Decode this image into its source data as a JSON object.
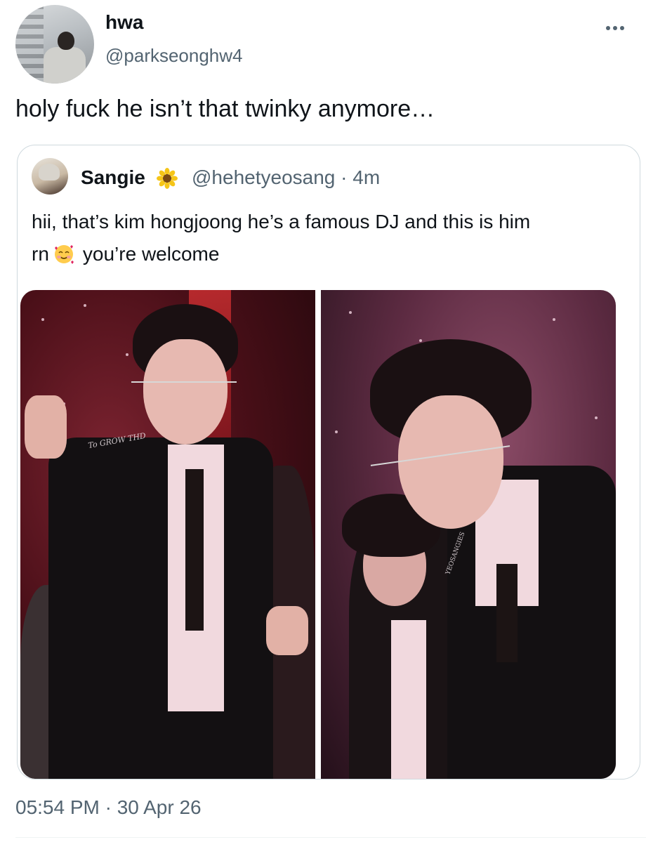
{
  "tweet": {
    "author": {
      "display_name": "hwa",
      "handle": "@parkseonghw4"
    },
    "text": "holy fuck he isn’t that twinky anymore…",
    "timestamp": "05:54 PM · 30 Apr 26",
    "more_icon": "more-horizontal-icon"
  },
  "quote": {
    "author": {
      "display_name": "Sangie",
      "handle": "@hehetyeosang",
      "time": "4m",
      "separator": " · "
    },
    "name_emoji_icon": "sunflower-icon",
    "text_line1": "hii, that’s kim hongjoong he’s a famous DJ and this is him",
    "text_line2_start": "rn",
    "text_emoji_icon": "smiling-face-with-hearts-icon",
    "text_line2_end": "you’re welcome",
    "photos": [
      {
        "name": "photo-performer-pointing",
        "watermark": "To GROW THD"
      },
      {
        "name": "photo-performer-leaning",
        "watermark": "YEOSANGIES"
      }
    ]
  },
  "colors": {
    "text": "#0f1419",
    "secondary": "#536471",
    "border": "#cfd9de"
  }
}
